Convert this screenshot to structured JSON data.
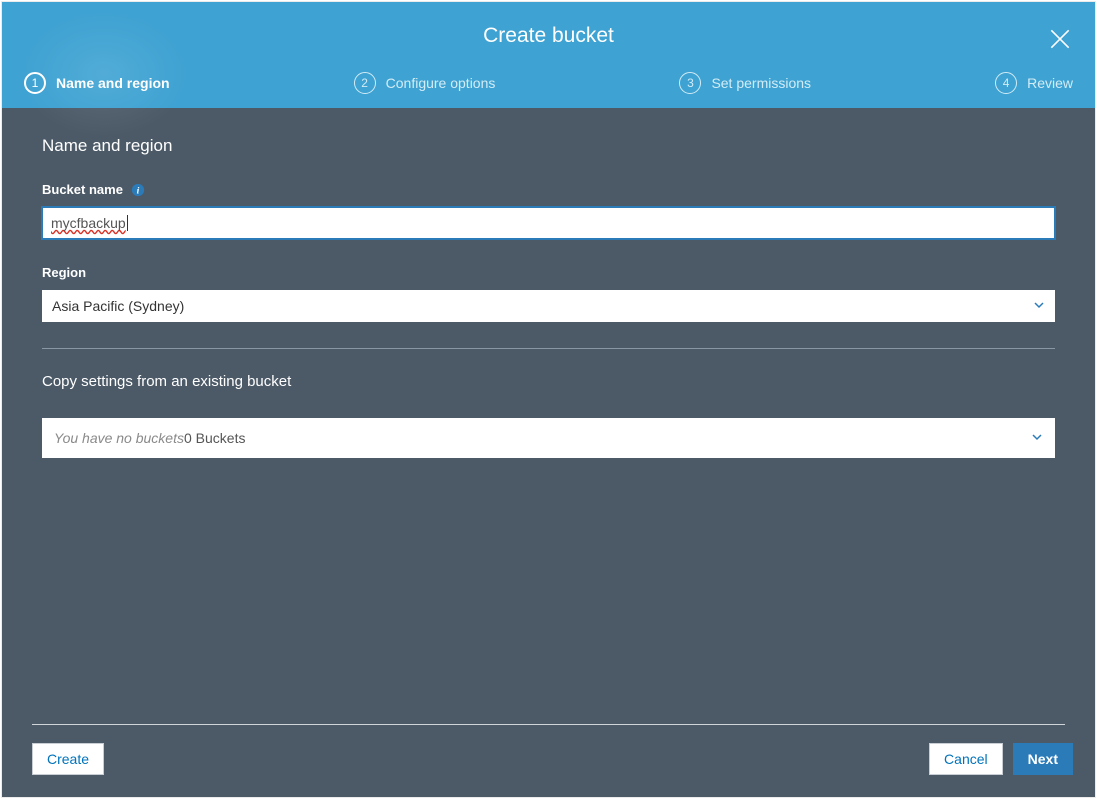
{
  "header": {
    "title": "Create bucket",
    "steps": [
      {
        "num": "1",
        "label": "Name and region",
        "active": true
      },
      {
        "num": "2",
        "label": "Configure options",
        "active": false
      },
      {
        "num": "3",
        "label": "Set permissions",
        "active": false
      },
      {
        "num": "4",
        "label": "Review",
        "active": false
      }
    ]
  },
  "form": {
    "section_heading": "Name and region",
    "bucket_name_label": "Bucket name",
    "bucket_name_value": "mycfbackup",
    "region_label": "Region",
    "region_value": "Asia Pacific (Sydney)",
    "copy_heading": "Copy settings from an existing bucket",
    "copy_placeholder": "You have no buckets",
    "copy_count": "0 Buckets"
  },
  "footer": {
    "create": "Create",
    "cancel": "Cancel",
    "next": "Next"
  }
}
